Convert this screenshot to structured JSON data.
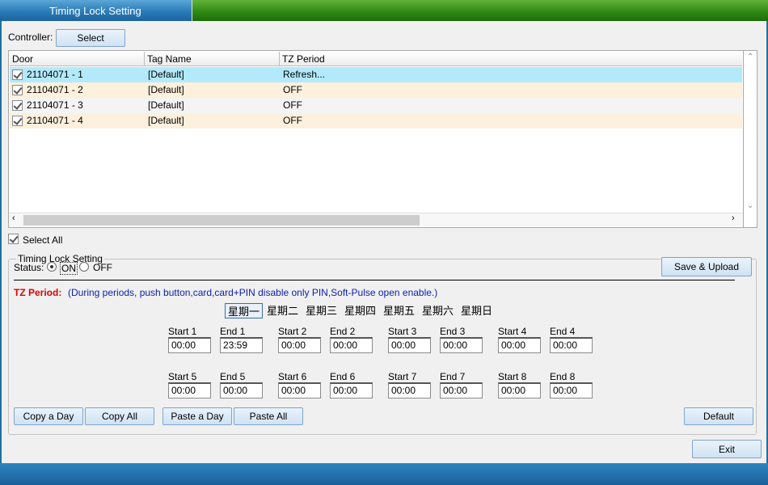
{
  "window": {
    "title": "Timing Lock Setting"
  },
  "controller": {
    "label": "Controller:",
    "select_label": "Select"
  },
  "grid": {
    "columns": [
      "Door",
      "Tag Name",
      "TZ Period"
    ],
    "rows": [
      {
        "door": "21104071 - 1",
        "tag": "[Default]",
        "tz": "Refresh...",
        "checked": true
      },
      {
        "door": "21104071 - 2",
        "tag": "[Default]",
        "tz": "OFF",
        "checked": true
      },
      {
        "door": "21104071 - 3",
        "tag": "[Default]",
        "tz": "OFF",
        "checked": true
      },
      {
        "door": "21104071 - 4",
        "tag": "[Default]",
        "tz": "OFF",
        "checked": true
      }
    ]
  },
  "select_all": {
    "label": "Select All",
    "checked": true
  },
  "timing": {
    "group_title": "Timing Lock Setting",
    "status_label": "Status:",
    "on_label": "ON",
    "off_label": "OFF",
    "save_upload_label": "Save & Upload",
    "tz_period_label": "TZ Period:",
    "tz_period_note": "(During periods, push button,card,card+PIN disable only PIN,Soft-Pulse open enable.)",
    "days": [
      "星期一",
      "星期二",
      "星期三",
      "星期四",
      "星期五",
      "星期六",
      "星期日"
    ],
    "selected_day": "星期一",
    "row1": {
      "labels": [
        "Start 1",
        "End 1",
        "Start 2",
        "End 2",
        "Start 3",
        "End 3",
        "Start 4",
        "End 4"
      ],
      "values": [
        "00:00",
        "23:59",
        "00:00",
        "00:00",
        "00:00",
        "00:00",
        "00:00",
        "00:00"
      ]
    },
    "row2": {
      "labels": [
        "Start 5",
        "End 5",
        "Start 6",
        "End 6",
        "Start 7",
        "End 7",
        "Start 8",
        "End 8"
      ],
      "values": [
        "00:00",
        "00:00",
        "00:00",
        "00:00",
        "00:00",
        "00:00",
        "00:00",
        "00:00"
      ]
    },
    "buttons": {
      "copy_day": "Copy a Day",
      "copy_all": "Copy All",
      "paste_day": "Paste a Day",
      "paste_all": "Paste All",
      "default": "Default"
    }
  },
  "exit_label": "Exit",
  "colors": {
    "row_selected": "#b3eafb",
    "row_alt": "#fdf0dc",
    "tz_label": "#e00000",
    "note": "#1020b0"
  }
}
